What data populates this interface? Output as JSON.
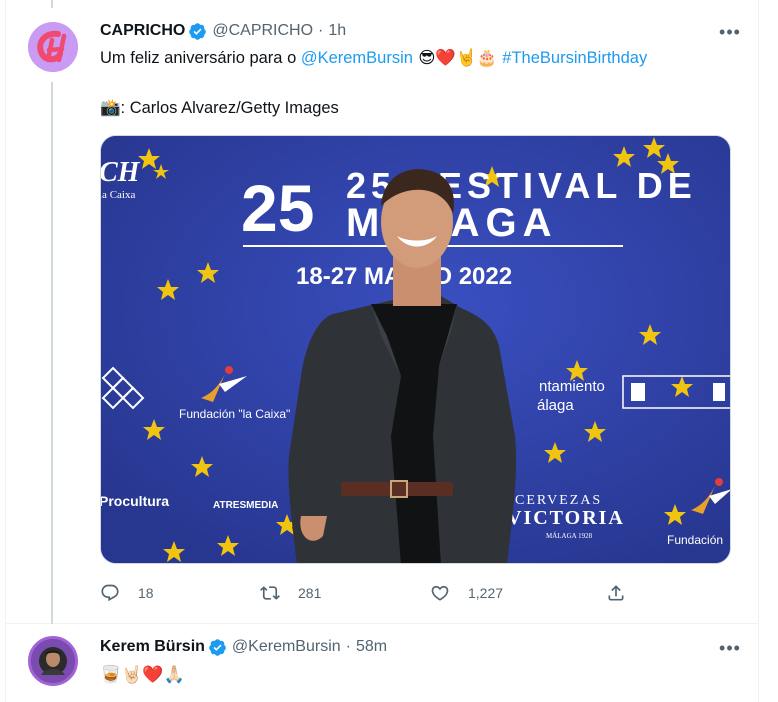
{
  "tweet1": {
    "name": "CAPRICHO",
    "handle": "@CAPRICHO",
    "separator": "·",
    "time": "1h",
    "text_prefix": "Um feliz aniversário para o ",
    "mention": "@KeremBursin",
    "emojis": " 😎❤️🤘🎂 ",
    "hashtag": "#TheBursinBirthday",
    "credit_emoji": "📸",
    "credit_text": ": Carlos Alvarez/Getty Images",
    "photo": {
      "banner_line1": "25 FESTIVAL DE",
      "banner_line2": "MÁLAGA",
      "banner_dates": "18-27 MARZO 2022",
      "sponsor_fundacion": "Fundación \"la Caixa\"",
      "sponsor_procultura": "Procultura",
      "sponsor_atresmedia": "ATRESMEDIA",
      "sponsor_cervezas": "CERVEZAS",
      "sponsor_victoria": "VICTORIA",
      "sponsor_malaga": "MÁLAGA 1928",
      "sponsor_ayuntamiento_1": "ntamiento",
      "sponsor_ayuntamiento_2": "álaga",
      "sponsor_caixa_small": "la Caixa",
      "sponsor_fundacion_right": "Fundación"
    },
    "actions": {
      "replies": "18",
      "retweets": "281",
      "likes": "1,227"
    }
  },
  "tweet2": {
    "name": "Kerem Bürsin",
    "handle": "@KeremBursin",
    "separator": "·",
    "time": "58m",
    "text": "🥃🤘🏻❤️🙏🏻"
  },
  "colors": {
    "accent": "#1d9bf0",
    "muted": "#536471",
    "banner_blue": "#2c3d9e"
  },
  "icons": {
    "verified": "verified-badge-icon",
    "more": "more-dots-icon",
    "reply": "reply-icon",
    "retweet": "retweet-icon",
    "like": "heart-icon",
    "share": "share-icon"
  }
}
